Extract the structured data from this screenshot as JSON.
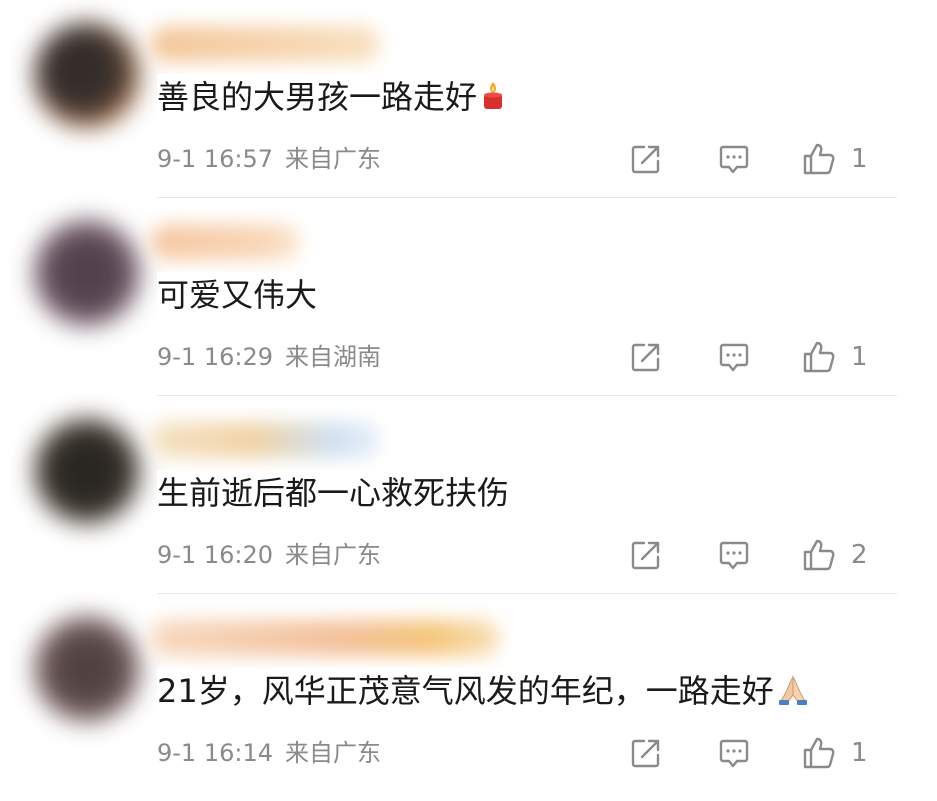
{
  "comments": [
    {
      "text": "善良的大男孩一路走好",
      "emoji": "candle-emoji",
      "time": "9-1 16:57",
      "location": "来自广东",
      "likes": "1",
      "avatar_color": "#3a3330",
      "avatar_edge": "#c97a42",
      "name_color": "#f3c79a"
    },
    {
      "text": "可爱又伟大",
      "emoji": "",
      "time": "9-1 16:29",
      "location": "来自湖南",
      "likes": "1",
      "avatar_color": "#5a4a55",
      "avatar_edge": "#8a6a7a",
      "name_color": "#f6c8a3"
    },
    {
      "text": "生前逝后都一心救死扶伤",
      "emoji": "",
      "time": "9-1 16:20",
      "location": "来自广东",
      "likes": "2",
      "avatar_color": "#2e2a25",
      "avatar_edge": "#6e6150",
      "name_color": "#f0d3a6"
    },
    {
      "text": "21岁，风华正茂意气风发的年纪，一路走好",
      "emoji": "folded-hands-emoji",
      "time": "9-1 16:14",
      "location": "来自广东",
      "likes": "1",
      "avatar_color": "#5a4a4a",
      "avatar_edge": "#9a7a7a",
      "name_color": "#f3c09a"
    }
  ],
  "icons": {
    "share": "share-icon",
    "reply": "comment-icon",
    "like": "thumbs-up-icon"
  },
  "colors": {
    "text": "#1a1a1a",
    "meta": "#8a8a8a",
    "icon": "#8a8a8a",
    "divider": "#e8e8e8"
  }
}
